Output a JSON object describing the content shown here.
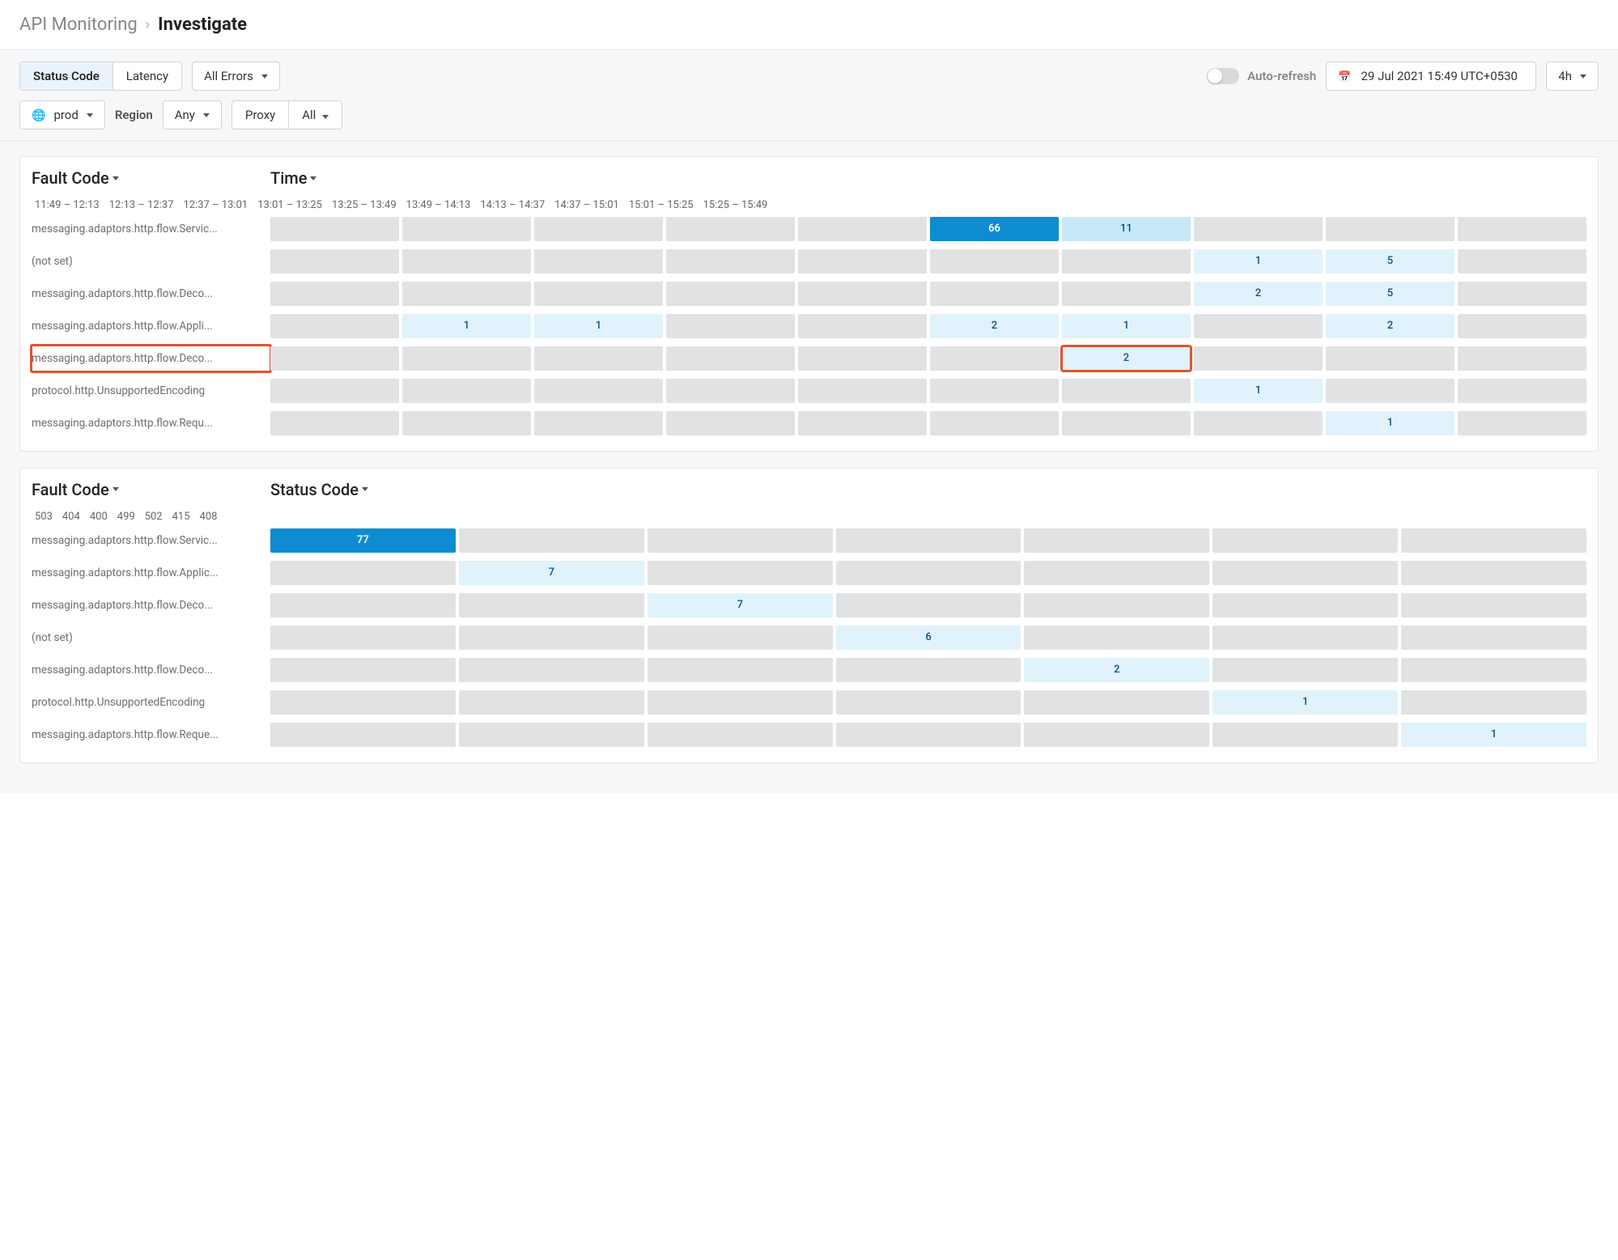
{
  "breadcrumb": {
    "section": "API Monitoring",
    "page": "Investigate"
  },
  "filters": {
    "tabs": [
      "Status Code",
      "Latency"
    ],
    "active_tab": 0,
    "error_filter": "All Errors",
    "env": "prod",
    "region_label": "Region",
    "region_value": "Any",
    "proxy_label": "Proxy",
    "proxy_value": "All",
    "auto_refresh_label": "Auto-refresh",
    "datetime": "29 Jul 2021 15:49 UTC+0530",
    "range": "4h"
  },
  "panel1": {
    "left_title": "Fault Code",
    "right_title": "Time",
    "columns": [
      "11:49 – 12:13",
      "12:13 – 12:37",
      "12:37 – 13:01",
      "13:01 – 13:25",
      "13:25 – 13:49",
      "13:49 – 14:13",
      "14:13 – 14:37",
      "14:37 – 15:01",
      "15:01 – 15:25",
      "15:25 – 15:49"
    ],
    "rows": [
      {
        "label": "messaging.adaptors.http.flow.Servic...",
        "cells": [
          null,
          null,
          null,
          null,
          null,
          {
            "v": 66,
            "lvl": 5
          },
          {
            "v": 11,
            "lvl": 2
          },
          null,
          null,
          null
        ]
      },
      {
        "label": "(not set)",
        "cells": [
          null,
          null,
          null,
          null,
          null,
          null,
          null,
          {
            "v": 1,
            "lvl": 1
          },
          {
            "v": 5,
            "lvl": 1
          },
          null
        ]
      },
      {
        "label": "messaging.adaptors.http.flow.Deco...",
        "cells": [
          null,
          null,
          null,
          null,
          null,
          null,
          null,
          {
            "v": 2,
            "lvl": 1
          },
          {
            "v": 5,
            "lvl": 1
          },
          null
        ]
      },
      {
        "label": "messaging.adaptors.http.flow.Appli...",
        "cells": [
          null,
          {
            "v": 1,
            "lvl": 1
          },
          {
            "v": 1,
            "lvl": 1
          },
          null,
          null,
          {
            "v": 2,
            "lvl": 1
          },
          {
            "v": 1,
            "lvl": 1
          },
          null,
          {
            "v": 2,
            "lvl": 1
          },
          null
        ]
      },
      {
        "label": "messaging.adaptors.http.flow.Deco...",
        "hl": true,
        "cells": [
          null,
          null,
          null,
          null,
          null,
          null,
          {
            "v": 2,
            "lvl": 1,
            "hl": true
          },
          null,
          null,
          null
        ]
      },
      {
        "label": "protocol.http.UnsupportedEncoding",
        "cells": [
          null,
          null,
          null,
          null,
          null,
          null,
          null,
          {
            "v": 1,
            "lvl": 1
          },
          null,
          null
        ]
      },
      {
        "label": "messaging.adaptors.http.flow.Requ...",
        "cells": [
          null,
          null,
          null,
          null,
          null,
          null,
          null,
          null,
          {
            "v": 1,
            "lvl": 1
          },
          null
        ]
      }
    ]
  },
  "panel2": {
    "left_title": "Fault Code",
    "right_title": "Status Code",
    "columns": [
      "503",
      "404",
      "400",
      "499",
      "502",
      "415",
      "408"
    ],
    "rows": [
      {
        "label": "messaging.adaptors.http.flow.Servic...",
        "cells": [
          {
            "v": 77,
            "lvl": 5
          },
          null,
          null,
          null,
          null,
          null,
          null
        ]
      },
      {
        "label": "messaging.adaptors.http.flow.Applic...",
        "cells": [
          null,
          {
            "v": 7,
            "lvl": 1
          },
          null,
          null,
          null,
          null,
          null
        ]
      },
      {
        "label": "messaging.adaptors.http.flow.Deco...",
        "cells": [
          null,
          null,
          {
            "v": 7,
            "lvl": 1
          },
          null,
          null,
          null,
          null
        ]
      },
      {
        "label": "(not set)",
        "cells": [
          null,
          null,
          null,
          {
            "v": 6,
            "lvl": 1
          },
          null,
          null,
          null
        ]
      },
      {
        "label": "messaging.adaptors.http.flow.Deco...",
        "cells": [
          null,
          null,
          null,
          null,
          {
            "v": 2,
            "lvl": 1
          },
          null,
          null
        ]
      },
      {
        "label": "protocol.http.UnsupportedEncoding",
        "cells": [
          null,
          null,
          null,
          null,
          null,
          {
            "v": 1,
            "lvl": 1
          },
          null
        ]
      },
      {
        "label": "messaging.adaptors.http.flow.Reque...",
        "cells": [
          null,
          null,
          null,
          null,
          null,
          null,
          {
            "v": 1,
            "lvl": 1
          }
        ]
      }
    ]
  },
  "chart_data": [
    {
      "type": "heatmap",
      "title": "Fault Code × Time",
      "xlabel": "Time",
      "ylabel": "Fault Code",
      "x": [
        "11:49 – 12:13",
        "12:13 – 12:37",
        "12:37 – 13:01",
        "13:01 – 13:25",
        "13:25 – 13:49",
        "13:49 – 14:13",
        "14:13 – 14:37",
        "14:37 – 15:01",
        "15:01 – 15:25",
        "15:25 – 15:49"
      ],
      "y": [
        "messaging.adaptors.http.flow.Servic...",
        "(not set)",
        "messaging.adaptors.http.flow.Deco...",
        "messaging.adaptors.http.flow.Appli...",
        "messaging.adaptors.http.flow.Deco...",
        "protocol.http.UnsupportedEncoding",
        "messaging.adaptors.http.flow.Requ..."
      ],
      "z": [
        [
          null,
          null,
          null,
          null,
          null,
          66,
          11,
          null,
          null,
          null
        ],
        [
          null,
          null,
          null,
          null,
          null,
          null,
          null,
          1,
          5,
          null
        ],
        [
          null,
          null,
          null,
          null,
          null,
          null,
          null,
          2,
          5,
          null
        ],
        [
          null,
          1,
          1,
          null,
          null,
          2,
          1,
          null,
          2,
          null
        ],
        [
          null,
          null,
          null,
          null,
          null,
          null,
          2,
          null,
          null,
          null
        ],
        [
          null,
          null,
          null,
          null,
          null,
          null,
          null,
          1,
          null,
          null
        ],
        [
          null,
          null,
          null,
          null,
          null,
          null,
          null,
          null,
          1,
          null
        ]
      ]
    },
    {
      "type": "heatmap",
      "title": "Fault Code × Status Code",
      "xlabel": "Status Code",
      "ylabel": "Fault Code",
      "x": [
        "503",
        "404",
        "400",
        "499",
        "502",
        "415",
        "408"
      ],
      "y": [
        "messaging.adaptors.http.flow.Servic...",
        "messaging.adaptors.http.flow.Applic...",
        "messaging.adaptors.http.flow.Deco...",
        "(not set)",
        "messaging.adaptors.http.flow.Deco...",
        "protocol.http.UnsupportedEncoding",
        "messaging.adaptors.http.flow.Reque..."
      ],
      "z": [
        [
          77,
          null,
          null,
          null,
          null,
          null,
          null
        ],
        [
          null,
          7,
          null,
          null,
          null,
          null,
          null
        ],
        [
          null,
          null,
          7,
          null,
          null,
          null,
          null
        ],
        [
          null,
          null,
          null,
          6,
          null,
          null,
          null
        ],
        [
          null,
          null,
          null,
          null,
          2,
          null,
          null
        ],
        [
          null,
          null,
          null,
          null,
          null,
          1,
          null
        ],
        [
          null,
          null,
          null,
          null,
          null,
          null,
          1
        ]
      ]
    }
  ]
}
